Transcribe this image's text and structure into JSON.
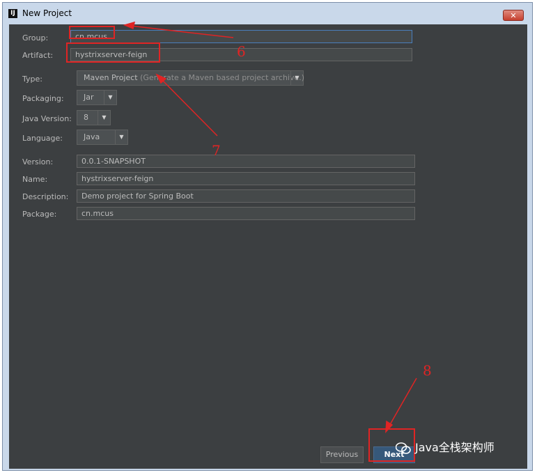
{
  "window": {
    "title": "New Project",
    "app_icon_text": "IJ",
    "close_glyph": "✕"
  },
  "form": {
    "group": {
      "label": "Group:",
      "value": "cn.mcus"
    },
    "artifact": {
      "label": "Artifact:",
      "value": "hystrixserver-feign"
    },
    "type": {
      "label": "Type:",
      "value": "Maven Project",
      "hint": "(Generate a Maven based project archive.)"
    },
    "packaging": {
      "label": "Packaging:",
      "value": "Jar"
    },
    "java_version": {
      "label": "Java Version:",
      "value": "8"
    },
    "language": {
      "label": "Language:",
      "value": "Java"
    },
    "version": {
      "label": "Version:",
      "value": "0.0.1-SNAPSHOT"
    },
    "name": {
      "label": "Name:",
      "value": "hystrixserver-feign"
    },
    "description": {
      "label": "Description:",
      "value": "Demo project for Spring Boot"
    },
    "package": {
      "label": "Package:",
      "value": "cn.mcus"
    }
  },
  "buttons": {
    "previous": "Previous",
    "next": "Next"
  },
  "annotations": {
    "n6": "6",
    "n7": "7",
    "n8": "8",
    "color": "#e02424"
  },
  "watermark": {
    "text": "Java全栈架构师",
    "icon": "wechat-icon"
  },
  "icons": {
    "dropdown": "▼"
  }
}
